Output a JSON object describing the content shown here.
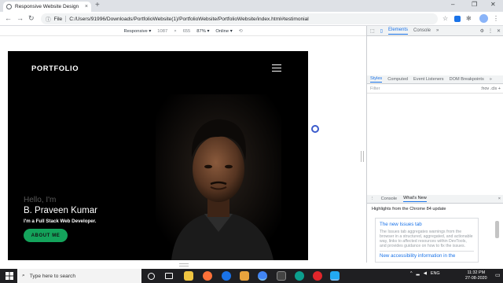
{
  "browser": {
    "tab_title": "Responsive Website Design",
    "tab_close": "×",
    "new_tab": "+",
    "omnibox": {
      "scheme_label": "File",
      "url": "C:/Users/91996/Downloads/PortfolioWebsite(1)/PortfolioWebsite/PortfolioWebsite/index.html#testimonial"
    }
  },
  "device_toolbar": {
    "device": "Responsive ▾",
    "width": "1087",
    "times": "×",
    "height": "655",
    "zoom": "87% ▾",
    "throttle": "Online ▾"
  },
  "portfolio": {
    "brand": "PORTFOLIO",
    "hello": "Hello, I'm",
    "name": "B. Praveen Kumar",
    "role": "I'm a Full Stack Web Developer.",
    "about_button": "ABOUT ME"
  },
  "devtools": {
    "top_tabs": [
      "Elements",
      "Console"
    ],
    "more": "»",
    "sub_tabs": [
      "Styles",
      "Computed",
      "Event Listeners",
      "DOM Breakpoints"
    ],
    "filter_placeholder": "Filter",
    "filter_right": ":hov .cls +",
    "drawer_tabs": [
      "Console",
      "What's New"
    ],
    "drawer_close": "×",
    "highlights": "Highlights from the Chrome 84 update",
    "card": {
      "title1": "The new Issues tab",
      "text1": "The Issues tab aggregates warnings from the browser in a structured, aggregated, and actionable way, links to affected resources within DevTools, and provides guidance on how to fix the issues.",
      "title2": "New accessibility information in the"
    }
  },
  "taskbar": {
    "search_placeholder": "Type here to search",
    "lang": "ENG",
    "time": "11:32 PM",
    "date": "27-08-2020"
  },
  "colors": {
    "accent_green": "#14a35b",
    "devtools_blue": "#1a73e8",
    "page_bg": "#000000"
  }
}
